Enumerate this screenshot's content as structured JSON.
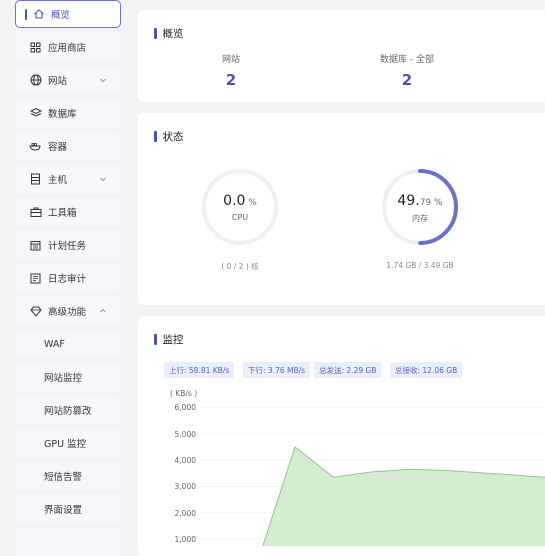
{
  "sidebar": {
    "items": [
      {
        "label": "概览",
        "icon": "home-icon",
        "active": true
      },
      {
        "label": "应用商店",
        "icon": "grid-icon"
      },
      {
        "label": "网站",
        "icon": "globe-icon",
        "chevron": "down"
      },
      {
        "label": "数据库",
        "icon": "layers-icon"
      },
      {
        "label": "容器",
        "icon": "whale-icon"
      },
      {
        "label": "主机",
        "icon": "server-icon",
        "chevron": "down"
      },
      {
        "label": "工具箱",
        "icon": "toolbox-icon"
      },
      {
        "label": "计划任务",
        "icon": "calendar-icon"
      },
      {
        "label": "日志审计",
        "icon": "log-icon"
      },
      {
        "label": "高级功能",
        "icon": "diamond-icon",
        "chevron": "up"
      },
      {
        "label": "WAF",
        "sub": true
      },
      {
        "label": "网站监控",
        "sub": true
      },
      {
        "label": "网站防篡改",
        "sub": true
      },
      {
        "label": "GPU 监控",
        "sub": true
      },
      {
        "label": "短信告警",
        "sub": true
      },
      {
        "label": "界面设置",
        "sub": true
      }
    ]
  },
  "overview": {
    "title": "概览",
    "website_label": "网站",
    "website_value": "2",
    "database_label": "数据库 - 全部",
    "database_value": "2"
  },
  "status": {
    "title": "状态",
    "cpu": {
      "value": "0.0",
      "pct": " %",
      "label": "CPU",
      "sub": "( 0 / 2 ) 核",
      "fraction": 0.0
    },
    "memory": {
      "value": "49.",
      "value_small": "79 %",
      "label": "内存",
      "sub": "1.74 GB / 3.49 GB",
      "fraction": 0.4979
    }
  },
  "monitor": {
    "title": "监控",
    "tags": [
      "上行: 58.81 KB/s",
      "下行: 3.76 MB/s",
      "总发送: 2.29 GB",
      "总接收: 12.06 GB"
    ],
    "unit": "( KB/s )",
    "yticks": [
      "6,000",
      "5,000",
      "4,000",
      "3,000",
      "2,000",
      "1,000"
    ]
  },
  "chart_data": {
    "type": "area",
    "ylabel": "( KB/s )",
    "ylim": [
      0,
      6000
    ],
    "series": [
      {
        "values": [
          0,
          0,
          4500,
          3350,
          3550,
          3650,
          3600,
          3500
        ]
      }
    ],
    "fill": "#c8e6c3",
    "stroke": "#8ccb84"
  },
  "colors": {
    "accent": "#4d54b0",
    "gauge_track": "#eef0f5",
    "gauge_fill": "#6b71c9"
  }
}
